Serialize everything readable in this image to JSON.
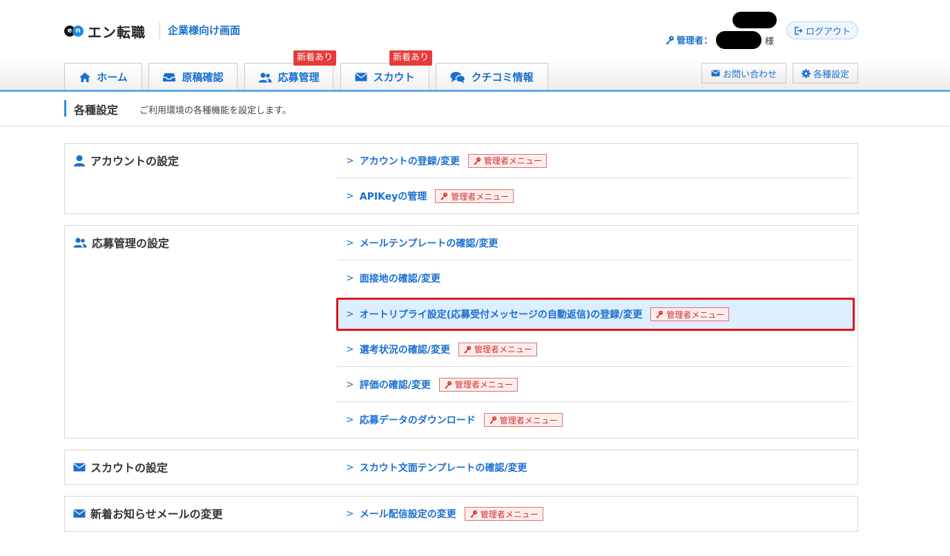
{
  "header": {
    "logo_mark_left": "e",
    "logo_mark_right": "n",
    "logo_text": "エン転職",
    "subtitle": "企業様向け画面",
    "admin_label": "管理者：",
    "admin_suffix": "様",
    "logout_label": "ログアウト"
  },
  "tabs": [
    {
      "label": "ホーム",
      "icon": "home-icon"
    },
    {
      "label": "原稿確認",
      "icon": "inbox-icon"
    },
    {
      "label": "応募管理",
      "icon": "users-icon",
      "badge": "新着あり"
    },
    {
      "label": "スカウト",
      "icon": "mail-icon",
      "badge": "新着あり"
    },
    {
      "label": "クチコミ情報",
      "icon": "chat-icon"
    }
  ],
  "header_buttons": {
    "contact_label": "お問い合わせ",
    "settings_label": "各種設定"
  },
  "page": {
    "title": "各種設定",
    "description": "ご利用環境の各種機能を設定します。"
  },
  "admin_badge_label": "管理者メニュー",
  "sections": [
    {
      "title": "アカウントの設定",
      "icon": "user-icon",
      "items": [
        {
          "label": "アカウントの登録/変更",
          "admin": true
        },
        {
          "label": "APIKeyの管理",
          "admin": true
        }
      ]
    },
    {
      "title": "応募管理の設定",
      "icon": "users-icon",
      "items": [
        {
          "label": "メールテンプレートの確認/変更",
          "admin": false
        },
        {
          "label": "面接地の確認/変更",
          "admin": false
        },
        {
          "label": "オートリプライ設定(応募受付メッセージの自動返信)の登録/変更",
          "admin": true,
          "highlighted": true
        },
        {
          "label": "選考状況の確認/変更",
          "admin": true
        },
        {
          "label": "評価の確認/変更",
          "admin": true
        },
        {
          "label": "応募データのダウンロード",
          "admin": true
        }
      ]
    },
    {
      "title": "スカウトの設定",
      "icon": "mail-icon",
      "items": [
        {
          "label": "スカウト文面テンプレートの確認/変更",
          "admin": false
        }
      ]
    },
    {
      "title": "新着お知らせメールの変更",
      "icon": "mail-icon",
      "items": [
        {
          "label": "メール配信設定の変更",
          "admin": true
        }
      ]
    }
  ],
  "colors": {
    "accent": "#1a6fcf",
    "tab_line": "#5ea7ea",
    "badge_red": "#e83a3a",
    "highlight_border": "#e0141e",
    "highlight_bg": "#dceeff"
  }
}
